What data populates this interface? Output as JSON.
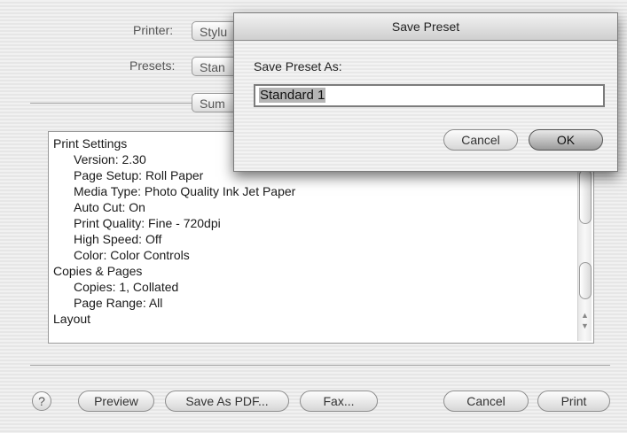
{
  "dialog": {
    "printer_label": "Printer:",
    "printer_value": "Stylu",
    "presets_label": "Presets:",
    "presets_value": "Stan",
    "section_value": "Sum"
  },
  "summary": {
    "rows": [
      {
        "text": "Print Settings",
        "indent": 0
      },
      {
        "text": "Version:  2.30",
        "indent": 1
      },
      {
        "text": "Page Setup:  Roll Paper",
        "indent": 1
      },
      {
        "text": "Media Type:  Photo Quality Ink Jet Paper",
        "indent": 1
      },
      {
        "text": "Auto Cut:  On",
        "indent": 1
      },
      {
        "text": "Print Quality:  Fine - 720dpi",
        "indent": 1
      },
      {
        "text": "High Speed:  Off",
        "indent": 1
      },
      {
        "text": "Color:  Color Controls",
        "indent": 1
      },
      {
        "text": "Copies & Pages",
        "indent": 0
      },
      {
        "text": "Copies:  1, Collated",
        "indent": 1
      },
      {
        "text": "Page Range:  All",
        "indent": 1
      },
      {
        "text": "Layout",
        "indent": 0
      }
    ]
  },
  "buttons": {
    "help": "?",
    "preview": "Preview",
    "save_as_pdf": "Save As PDF...",
    "fax": "Fax...",
    "cancel": "Cancel",
    "print": "Print"
  },
  "sheet": {
    "title": "Save Preset",
    "prompt": "Save Preset As:",
    "input_value": "Standard 1",
    "cancel": "Cancel",
    "ok": "OK"
  }
}
